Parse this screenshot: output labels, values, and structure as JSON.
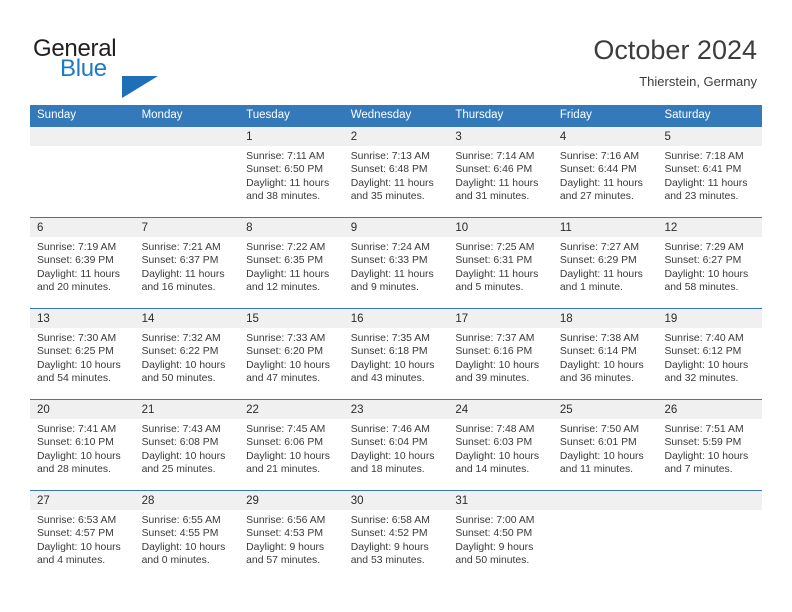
{
  "brand": {
    "line1": "General",
    "line2": "Blue",
    "triangle_color": "#1f6fb8"
  },
  "header": {
    "title": "October 2024",
    "subtitle": "Thierstein, Germany"
  },
  "theme": {
    "header_blue": "#3479b9",
    "day_band_grey": "#f0f0f0",
    "text_dark": "#3a3a3a"
  },
  "weekdays": [
    "Sunday",
    "Monday",
    "Tuesday",
    "Wednesday",
    "Thursday",
    "Friday",
    "Saturday"
  ],
  "weeks": [
    [
      {
        "day": "",
        "lines": []
      },
      {
        "day": "",
        "lines": []
      },
      {
        "day": "1",
        "lines": [
          "Sunrise: 7:11 AM",
          "Sunset: 6:50 PM",
          "Daylight: 11 hours",
          "and 38 minutes."
        ]
      },
      {
        "day": "2",
        "lines": [
          "Sunrise: 7:13 AM",
          "Sunset: 6:48 PM",
          "Daylight: 11 hours",
          "and 35 minutes."
        ]
      },
      {
        "day": "3",
        "lines": [
          "Sunrise: 7:14 AM",
          "Sunset: 6:46 PM",
          "Daylight: 11 hours",
          "and 31 minutes."
        ]
      },
      {
        "day": "4",
        "lines": [
          "Sunrise: 7:16 AM",
          "Sunset: 6:44 PM",
          "Daylight: 11 hours",
          "and 27 minutes."
        ]
      },
      {
        "day": "5",
        "lines": [
          "Sunrise: 7:18 AM",
          "Sunset: 6:41 PM",
          "Daylight: 11 hours",
          "and 23 minutes."
        ]
      }
    ],
    [
      {
        "day": "6",
        "lines": [
          "Sunrise: 7:19 AM",
          "Sunset: 6:39 PM",
          "Daylight: 11 hours",
          "and 20 minutes."
        ]
      },
      {
        "day": "7",
        "lines": [
          "Sunrise: 7:21 AM",
          "Sunset: 6:37 PM",
          "Daylight: 11 hours",
          "and 16 minutes."
        ]
      },
      {
        "day": "8",
        "lines": [
          "Sunrise: 7:22 AM",
          "Sunset: 6:35 PM",
          "Daylight: 11 hours",
          "and 12 minutes."
        ]
      },
      {
        "day": "9",
        "lines": [
          "Sunrise: 7:24 AM",
          "Sunset: 6:33 PM",
          "Daylight: 11 hours",
          "and 9 minutes."
        ]
      },
      {
        "day": "10",
        "lines": [
          "Sunrise: 7:25 AM",
          "Sunset: 6:31 PM",
          "Daylight: 11 hours",
          "and 5 minutes."
        ]
      },
      {
        "day": "11",
        "lines": [
          "Sunrise: 7:27 AM",
          "Sunset: 6:29 PM",
          "Daylight: 11 hours",
          "and 1 minute."
        ]
      },
      {
        "day": "12",
        "lines": [
          "Sunrise: 7:29 AM",
          "Sunset: 6:27 PM",
          "Daylight: 10 hours",
          "and 58 minutes."
        ]
      }
    ],
    [
      {
        "day": "13",
        "lines": [
          "Sunrise: 7:30 AM",
          "Sunset: 6:25 PM",
          "Daylight: 10 hours",
          "and 54 minutes."
        ]
      },
      {
        "day": "14",
        "lines": [
          "Sunrise: 7:32 AM",
          "Sunset: 6:22 PM",
          "Daylight: 10 hours",
          "and 50 minutes."
        ]
      },
      {
        "day": "15",
        "lines": [
          "Sunrise: 7:33 AM",
          "Sunset: 6:20 PM",
          "Daylight: 10 hours",
          "and 47 minutes."
        ]
      },
      {
        "day": "16",
        "lines": [
          "Sunrise: 7:35 AM",
          "Sunset: 6:18 PM",
          "Daylight: 10 hours",
          "and 43 minutes."
        ]
      },
      {
        "day": "17",
        "lines": [
          "Sunrise: 7:37 AM",
          "Sunset: 6:16 PM",
          "Daylight: 10 hours",
          "and 39 minutes."
        ]
      },
      {
        "day": "18",
        "lines": [
          "Sunrise: 7:38 AM",
          "Sunset: 6:14 PM",
          "Daylight: 10 hours",
          "and 36 minutes."
        ]
      },
      {
        "day": "19",
        "lines": [
          "Sunrise: 7:40 AM",
          "Sunset: 6:12 PM",
          "Daylight: 10 hours",
          "and 32 minutes."
        ]
      }
    ],
    [
      {
        "day": "20",
        "lines": [
          "Sunrise: 7:41 AM",
          "Sunset: 6:10 PM",
          "Daylight: 10 hours",
          "and 28 minutes."
        ]
      },
      {
        "day": "21",
        "lines": [
          "Sunrise: 7:43 AM",
          "Sunset: 6:08 PM",
          "Daylight: 10 hours",
          "and 25 minutes."
        ]
      },
      {
        "day": "22",
        "lines": [
          "Sunrise: 7:45 AM",
          "Sunset: 6:06 PM",
          "Daylight: 10 hours",
          "and 21 minutes."
        ]
      },
      {
        "day": "23",
        "lines": [
          "Sunrise: 7:46 AM",
          "Sunset: 6:04 PM",
          "Daylight: 10 hours",
          "and 18 minutes."
        ]
      },
      {
        "day": "24",
        "lines": [
          "Sunrise: 7:48 AM",
          "Sunset: 6:03 PM",
          "Daylight: 10 hours",
          "and 14 minutes."
        ]
      },
      {
        "day": "25",
        "lines": [
          "Sunrise: 7:50 AM",
          "Sunset: 6:01 PM",
          "Daylight: 10 hours",
          "and 11 minutes."
        ]
      },
      {
        "day": "26",
        "lines": [
          "Sunrise: 7:51 AM",
          "Sunset: 5:59 PM",
          "Daylight: 10 hours",
          "and 7 minutes."
        ]
      }
    ],
    [
      {
        "day": "27",
        "lines": [
          "Sunrise: 6:53 AM",
          "Sunset: 4:57 PM",
          "Daylight: 10 hours",
          "and 4 minutes."
        ]
      },
      {
        "day": "28",
        "lines": [
          "Sunrise: 6:55 AM",
          "Sunset: 4:55 PM",
          "Daylight: 10 hours",
          "and 0 minutes."
        ]
      },
      {
        "day": "29",
        "lines": [
          "Sunrise: 6:56 AM",
          "Sunset: 4:53 PM",
          "Daylight: 9 hours",
          "and 57 minutes."
        ]
      },
      {
        "day": "30",
        "lines": [
          "Sunrise: 6:58 AM",
          "Sunset: 4:52 PM",
          "Daylight: 9 hours",
          "and 53 minutes."
        ]
      },
      {
        "day": "31",
        "lines": [
          "Sunrise: 7:00 AM",
          "Sunset: 4:50 PM",
          "Daylight: 9 hours",
          "and 50 minutes."
        ]
      },
      {
        "day": "",
        "lines": []
      },
      {
        "day": "",
        "lines": []
      }
    ]
  ]
}
